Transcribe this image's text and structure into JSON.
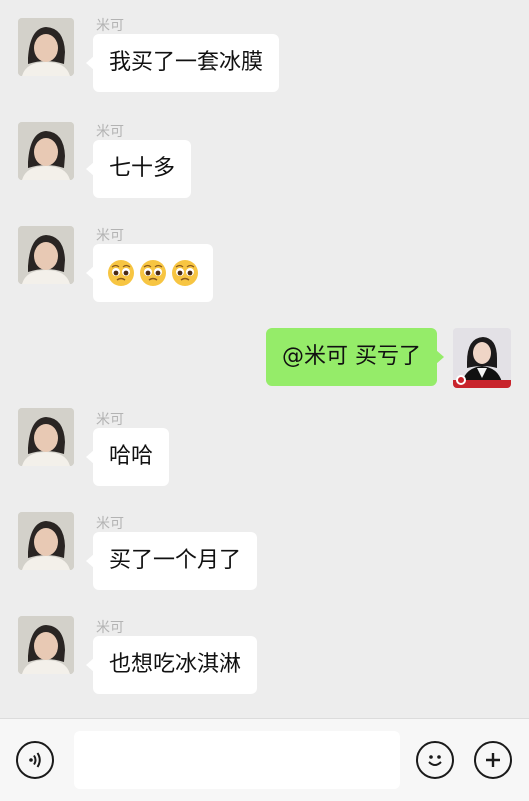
{
  "messages": [
    {
      "side": "left",
      "sender": "米可",
      "text": "我买了一套冰膜"
    },
    {
      "side": "left",
      "sender": "米可",
      "text": "七十多"
    },
    {
      "side": "left",
      "sender": "米可",
      "emoji": [
        "pleading-face-icon",
        "pleading-face-icon",
        "pleading-face-icon"
      ]
    },
    {
      "side": "right",
      "text": "@米可  买亏了"
    },
    {
      "side": "left",
      "sender": "米可",
      "text": "哈哈"
    },
    {
      "side": "left",
      "sender": "米可",
      "text": "买了一个月了"
    },
    {
      "side": "left",
      "sender": "米可",
      "text": "也想吃冰淇淋"
    }
  ],
  "colors": {
    "background": "#ededed",
    "bubble_incoming": "#ffffff",
    "bubble_outgoing": "#95ec69",
    "sender_name": "#b3b3b3"
  },
  "bottom_bar": {
    "voice_icon": "voice-icon",
    "emoji_icon": "emoji-icon",
    "plus_icon": "plus-icon",
    "input_value": ""
  }
}
